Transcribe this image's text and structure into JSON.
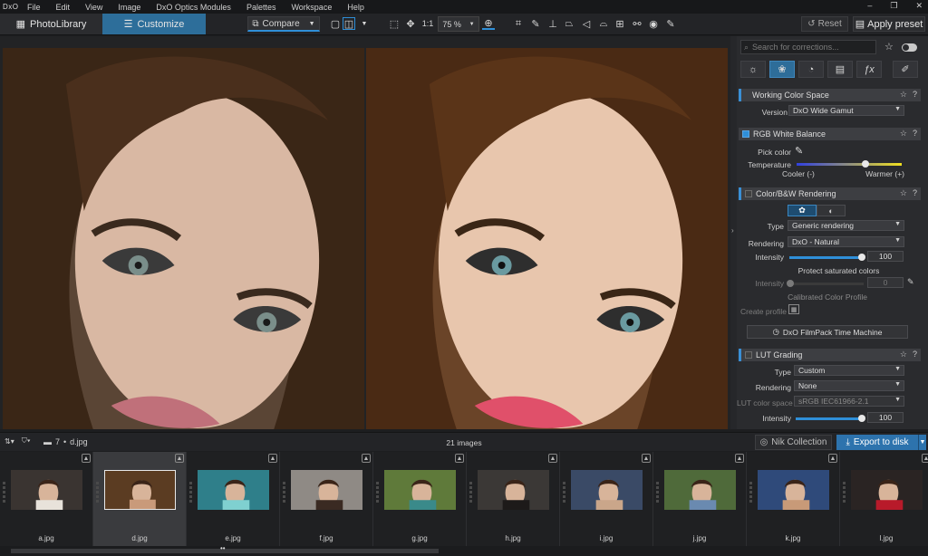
{
  "app": {
    "logo": "DxO"
  },
  "menu": [
    "File",
    "Edit",
    "View",
    "Image",
    "DxO Optics Modules",
    "Palettes",
    "Workspace",
    "Help"
  ],
  "window_controls": [
    "–",
    "❐",
    "✕"
  ],
  "tabs": {
    "photolibrary": "PhotoLibrary",
    "customize": "Customize"
  },
  "toolbar": {
    "compare": "Compare",
    "one_to_one": "1:1",
    "zoom": "75 %",
    "reset": "Reset",
    "apply_preset": "Apply preset"
  },
  "panel": {
    "search_placeholder": "Search for corrections...",
    "working_color_space": {
      "title": "Working Color Space",
      "version_label": "Version",
      "version_value": "DxO Wide Gamut"
    },
    "white_balance": {
      "title": "RGB White Balance",
      "pick_color": "Pick color",
      "temperature": "Temperature",
      "cooler": "Cooler (-)",
      "warmer": "Warmer (+)",
      "temperature_level": 0.28
    },
    "color_rendering": {
      "title": "Color/B&W Rendering",
      "type_label": "Type",
      "type_value": "Generic rendering",
      "rendering_label": "Rendering",
      "rendering_value": "DxO - Natural",
      "intensity_label": "Intensity",
      "intensity_value": "100",
      "protect": "Protect saturated colors",
      "protect_intensity_label": "Intensity",
      "protect_intensity_value": "0",
      "calibrated": "Calibrated Color Profile",
      "create_profile": "Create profile",
      "filmpack": "DxO FilmPack Time Machine"
    },
    "lut_grading": {
      "title": "LUT Grading",
      "type_label": "Type",
      "type_value": "Custom",
      "rendering_label": "Rendering",
      "rendering_value": "None",
      "colorspace_label": "LUT color space",
      "colorspace_value": "sRGB IEC61966-2.1",
      "intensity_label": "Intensity",
      "intensity_value": "100"
    }
  },
  "filmbar": {
    "folder_count": "7",
    "current_file": "d.jpg",
    "images_count": "21 images",
    "nik": "Nik Collection",
    "export": "Export to disk"
  },
  "filmstrip": [
    {
      "name": "a.jpg",
      "bg": "#3a3431",
      "fg": "#e8e2da",
      "selected": false
    },
    {
      "name": "d.jpg",
      "bg": "#5b3c22",
      "fg": "#c99a7a",
      "selected": true
    },
    {
      "name": "e.jpg",
      "bg": "#2f7f8a",
      "fg": "#7fd0d0",
      "selected": false
    },
    {
      "name": "f.jpg",
      "bg": "#8f8a85",
      "fg": "#3a2a22",
      "selected": false
    },
    {
      "name": "g.jpg",
      "bg": "#5f7a3a",
      "fg": "#3a8a8a",
      "selected": false
    },
    {
      "name": "h.jpg",
      "bg": "#3b3836",
      "fg": "#1d1a19",
      "selected": false
    },
    {
      "name": "i.jpg",
      "bg": "#3a4a66",
      "fg": "#caa68a",
      "selected": false
    },
    {
      "name": "j.jpg",
      "bg": "#4f6a3a",
      "fg": "#6a8ab0",
      "selected": false
    },
    {
      "name": "k.jpg",
      "bg": "#2f4a7a",
      "fg": "#c89a78",
      "selected": false
    },
    {
      "name": "l.jpg",
      "bg": "#2a2423",
      "fg": "#b81a2a",
      "selected": false
    }
  ]
}
